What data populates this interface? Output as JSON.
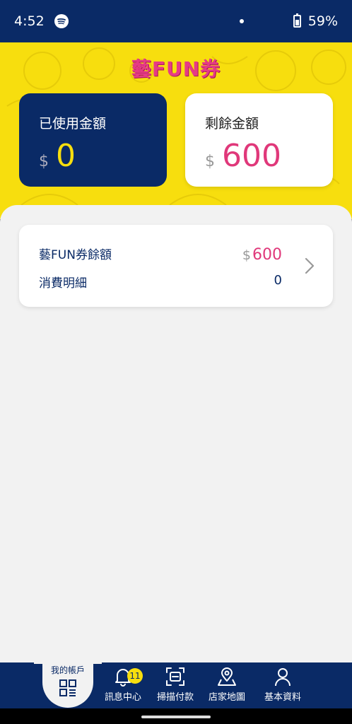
{
  "status_bar": {
    "time": "4:52",
    "battery": "59%"
  },
  "header": {
    "logo": "藝FUN券",
    "used_card": {
      "label": "已使用金額",
      "currency": "$",
      "amount": "0"
    },
    "remaining_card": {
      "label": "剩餘金額",
      "currency": "$",
      "amount": "600"
    }
  },
  "balance_card": {
    "balance_label": "藝FUN券餘額",
    "balance_currency": "$",
    "balance_value": "600",
    "details_label": "消費明細",
    "details_value": "0"
  },
  "bottom_nav": {
    "items": [
      {
        "label": "我的帳戶",
        "icon": "account-grid-icon",
        "active": true
      },
      {
        "label": "訊息中心",
        "icon": "bell-icon",
        "badge": "11"
      },
      {
        "label": "掃描付款",
        "icon": "scan-icon"
      },
      {
        "label": "店家地圖",
        "icon": "map-pin-icon"
      },
      {
        "label": "基本資料",
        "icon": "person-icon"
      }
    ]
  },
  "colors": {
    "navy": "#0a2a66",
    "yellow": "#f7de0e",
    "pink": "#e0387a"
  }
}
